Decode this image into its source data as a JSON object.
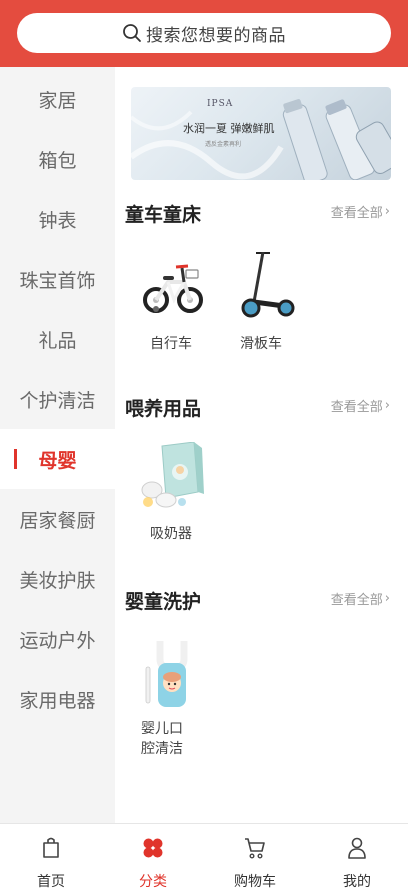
{
  "search": {
    "placeholder": "搜索您想要的商品",
    "icon": "search-icon"
  },
  "sidebar": {
    "items": [
      {
        "label": "家居"
      },
      {
        "label": "箱包"
      },
      {
        "label": "钟表"
      },
      {
        "label": "珠宝首饰"
      },
      {
        "label": "礼品"
      },
      {
        "label": "个护清洁"
      },
      {
        "label": "母婴",
        "active": true
      },
      {
        "label": "居家餐厨"
      },
      {
        "label": "美妆护肤"
      },
      {
        "label": "运动户外"
      },
      {
        "label": "家用电器"
      }
    ],
    "active_color": "#e0342b"
  },
  "banner": {
    "logo": "IPSA",
    "slogan": "水润一夏 弹嫩鲜肌",
    "sub": "透反金素再利"
  },
  "sections": [
    {
      "title": "童车童床",
      "view_all": "查看全部",
      "products": [
        {
          "name": "自行车",
          "icon": "bicycle-icon"
        },
        {
          "name": "滑板车",
          "icon": "scooter-icon"
        }
      ]
    },
    {
      "title": "喂养用品",
      "view_all": "查看全部",
      "products": [
        {
          "name": "吸奶器",
          "icon": "breast-pump-icon"
        }
      ]
    },
    {
      "title": "婴童洗护",
      "view_all": "查看全部",
      "products": [
        {
          "name": "婴儿口腔清洁",
          "icon": "toothbrush-icon"
        }
      ]
    }
  ],
  "tabbar": {
    "items": [
      {
        "label": "首页",
        "icon": "home-icon"
      },
      {
        "label": "分类",
        "icon": "category-icon",
        "active": true
      },
      {
        "label": "购物车",
        "icon": "cart-icon"
      },
      {
        "label": "我的",
        "icon": "user-icon"
      }
    ]
  },
  "colors": {
    "header": "#e44c3f",
    "accent": "#e0342b",
    "sidebar_bg": "#f4f4f4"
  }
}
